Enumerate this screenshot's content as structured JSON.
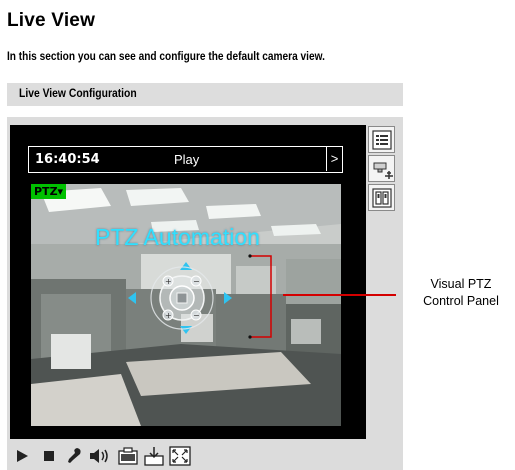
{
  "page": {
    "title": "Live View",
    "description": "In this section you can see and configure the default camera view."
  },
  "section": {
    "title": "Live View Configuration"
  },
  "viewer": {
    "time": "16:40:54",
    "mode": "Play",
    "next_arrow": ">",
    "ptz_badge": "PTZ▾",
    "overlay_text": "PTZ Automation",
    "side_icons": [
      "list-icon",
      "ptz-camera-icon",
      "preset-icon"
    ]
  },
  "toolbar": {
    "buttons": [
      "play-icon",
      "stop-icon",
      "microphone-icon",
      "speaker-icon",
      "snapshot-icon",
      "record-icon",
      "fullscreen-icon"
    ]
  },
  "callout": {
    "line1": "Visual PTZ",
    "line2": "Control Panel",
    "color": "#d40000"
  },
  "colors": {
    "ptz_badge": "#00c000",
    "overlay_text": "#2fe0ff",
    "section_bar": "#dddddd"
  }
}
